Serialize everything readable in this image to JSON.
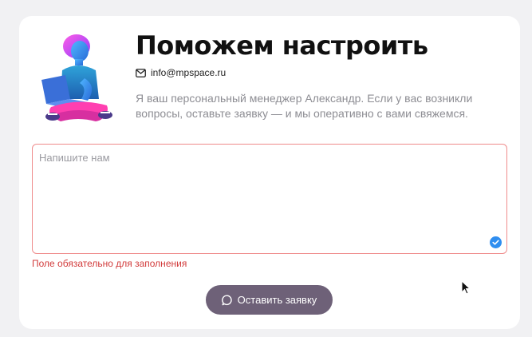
{
  "header": {
    "title": "Поможем настроить",
    "email": "info@mpspace.ru",
    "description": "Я ваш персональный менеджер Александр. Если у вас возникли вопросы, оставьте заявку — и мы оперативно с вами свяжемся."
  },
  "form": {
    "message_placeholder": "Напишите нам",
    "message_value": "",
    "error_text": "Поле обязательно для заполнения",
    "submit_label": "Оставить заявку"
  },
  "icons": {
    "email": "envelope-icon",
    "field_badge": "check-circle-icon",
    "submit": "chat-bubble-icon"
  },
  "colors": {
    "button": "#6e6178",
    "error": "#d23c3c",
    "error_border": "#ef8b8b",
    "badge": "#2f8ef0"
  }
}
